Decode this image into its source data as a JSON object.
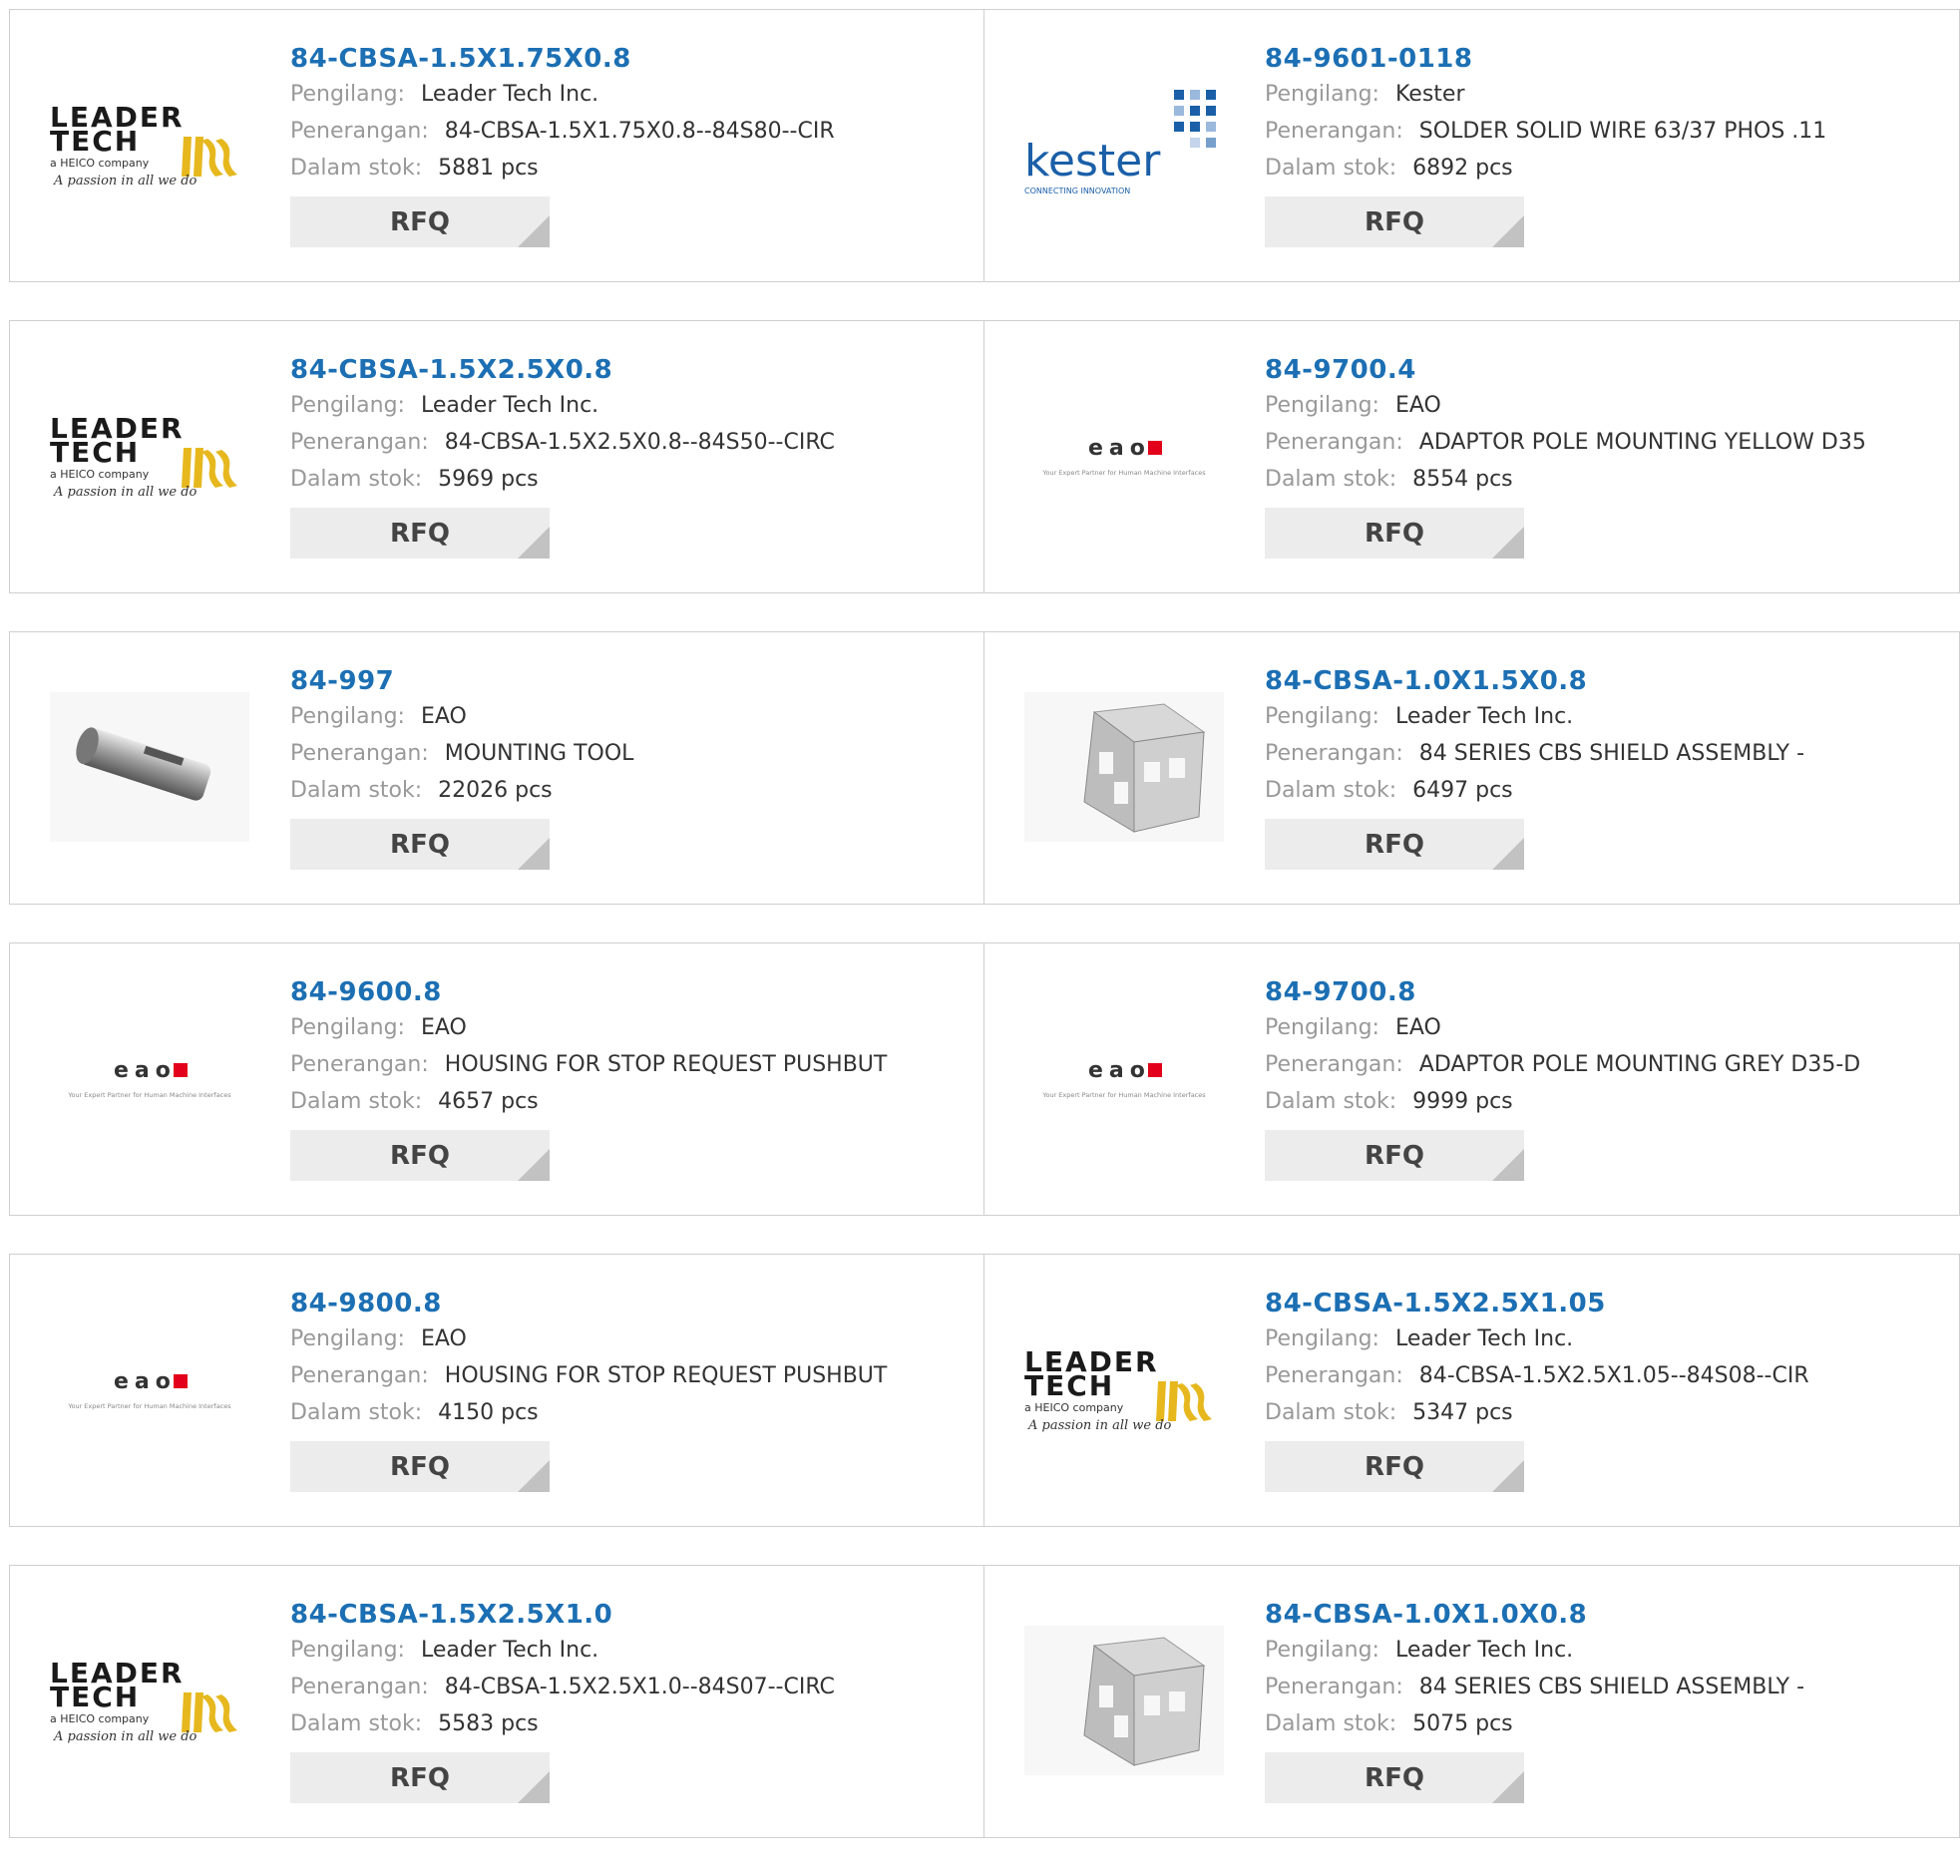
{
  "labels": {
    "manufacturer": "Pengilang:",
    "description": "Penerangan:",
    "stock": "Dalam stok:",
    "rfq": "RFQ"
  },
  "logos": {
    "leadertech": {
      "line1": "LEADER",
      "line2": "TECH",
      "line3": "a HEICO company",
      "line4": "A passion in all we do"
    },
    "kester": {
      "word": "kester",
      "tagline": "CONNECTING INNOVATION"
    },
    "eao": {
      "word": "eao",
      "tagline": "Your Expert Partner for Human Machine Interfaces"
    }
  },
  "colors": {
    "link": "#1c6fb3",
    "button_bg": "#ececec",
    "label": "#999999",
    "value": "#333333",
    "eao_red": "#e2001a",
    "kester_blue": "#1a5fa8"
  },
  "products": [
    {
      "pn": "84-CBSA-1.5X1.75X0.8",
      "manufacturer": "Leader Tech Inc.",
      "description": "84-CBSA-1.5X1.75X0.8--84S80--CIR",
      "stock": "5881 pcs",
      "logo": "leadertech"
    },
    {
      "pn": "84-9601-0118",
      "manufacturer": "Kester",
      "description": "SOLDER SOLID WIRE 63/37 PHOS .11",
      "stock": "6892 pcs",
      "logo": "kester"
    },
    {
      "pn": "84-CBSA-1.5X2.5X0.8",
      "manufacturer": "Leader Tech Inc.",
      "description": "84-CBSA-1.5X2.5X0.8--84S50--CIRC",
      "stock": "5969 pcs",
      "logo": "leadertech"
    },
    {
      "pn": "84-9700.4",
      "manufacturer": "EAO",
      "description": "ADAPTOR POLE MOUNTING YELLOW D35",
      "stock": "8554 pcs",
      "logo": "eao"
    },
    {
      "pn": "84-997",
      "manufacturer": "EAO",
      "description": "MOUNTING TOOL",
      "stock": "22026 pcs",
      "logo": "tube-photo"
    },
    {
      "pn": "84-CBSA-1.0X1.5X0.8",
      "manufacturer": "Leader Tech Inc.",
      "description": "84 SERIES CBS SHIELD ASSEMBLY -",
      "stock": "6497 pcs",
      "logo": "shield-photo"
    },
    {
      "pn": "84-9600.8",
      "manufacturer": "EAO",
      "description": "HOUSING FOR STOP REQUEST PUSHBUT",
      "stock": "4657 pcs",
      "logo": "eao"
    },
    {
      "pn": "84-9700.8",
      "manufacturer": "EAO",
      "description": "ADAPTOR POLE MOUNTING GREY D35-D",
      "stock": "9999 pcs",
      "logo": "eao"
    },
    {
      "pn": "84-9800.8",
      "manufacturer": "EAO",
      "description": "HOUSING FOR STOP REQUEST PUSHBUT",
      "stock": "4150 pcs",
      "logo": "eao"
    },
    {
      "pn": "84-CBSA-1.5X2.5X1.05",
      "manufacturer": "Leader Tech Inc.",
      "description": "84-CBSA-1.5X2.5X1.05--84S08--CIR",
      "stock": "5347 pcs",
      "logo": "leadertech"
    },
    {
      "pn": "84-CBSA-1.5X2.5X1.0",
      "manufacturer": "Leader Tech Inc.",
      "description": "84-CBSA-1.5X2.5X1.0--84S07--CIRC",
      "stock": "5583 pcs",
      "logo": "leadertech"
    },
    {
      "pn": "84-CBSA-1.0X1.0X0.8",
      "manufacturer": "Leader Tech Inc.",
      "description": "84 SERIES CBS SHIELD ASSEMBLY -",
      "stock": "5075 pcs",
      "logo": "shield-photo"
    }
  ]
}
